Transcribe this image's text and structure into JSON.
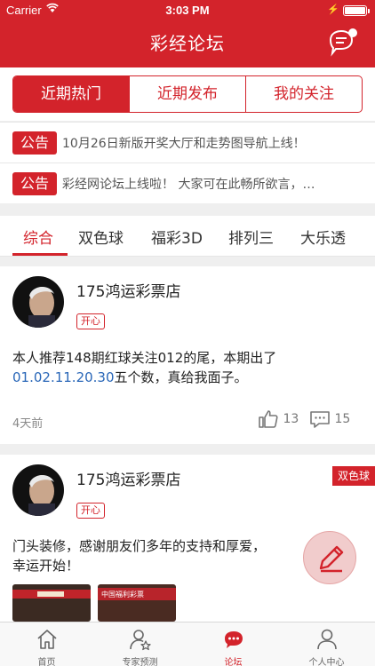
{
  "status_bar": {
    "carrier": "Carrier",
    "time": "3:03 PM"
  },
  "header": {
    "title": "彩经论坛"
  },
  "segments": [
    {
      "label": "近期热门",
      "active": true
    },
    {
      "label": "近期发布",
      "active": false
    },
    {
      "label": "我的关注",
      "active": false
    }
  ],
  "notices": [
    {
      "tag": "公告",
      "text": "10月26日新版开奖大厅和走势图导航上线！"
    },
    {
      "tag": "公告",
      "text": "彩经网论坛上线啦！ 大家可在此畅所欲言，…"
    }
  ],
  "category_tabs": [
    {
      "label": "综合",
      "active": true
    },
    {
      "label": "双色球",
      "active": false
    },
    {
      "label": "福彩3D",
      "active": false
    },
    {
      "label": "排列三",
      "active": false
    },
    {
      "label": "大乐透",
      "active": false
    }
  ],
  "posts": [
    {
      "username": "175鸿运彩票店",
      "mood": "开心",
      "text_line1": "本人推荐148期红球关注012的尾，本期出了",
      "numbers": "01.02.11.20.30",
      "text_line2": "五个数，真给我面子。",
      "time_ago": "4天前",
      "likes": "13",
      "comments": "15"
    },
    {
      "username": "175鸿运彩票店",
      "mood": "开心",
      "corner_tag": "双色球",
      "text_line1": "门头装修，感谢朋友们多年的支持和厚爱，",
      "text_line2": "幸运开始！",
      "thumb2_text": "中国福利彩票"
    }
  ],
  "tab_bar": [
    {
      "label": "首页",
      "icon": "home-icon",
      "active": false
    },
    {
      "label": "专家预测",
      "icon": "expert-icon",
      "active": false
    },
    {
      "label": "论坛",
      "icon": "forum-icon",
      "active": true
    },
    {
      "label": "个人中心",
      "icon": "person-icon",
      "active": false
    }
  ],
  "colors": {
    "accent": "#d3232b",
    "numbers_blue": "#2a67b8"
  }
}
